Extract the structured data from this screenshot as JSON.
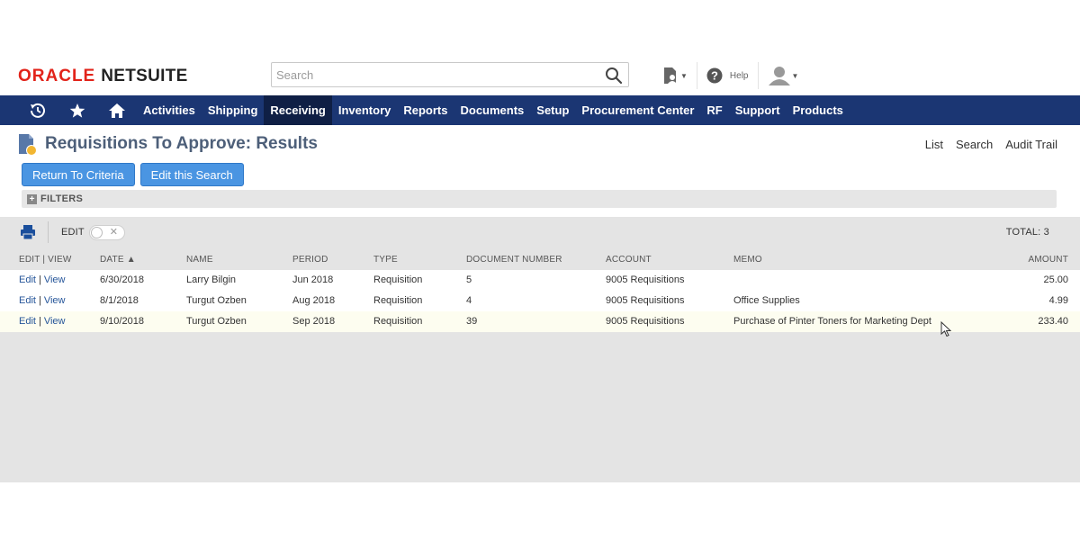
{
  "logo": {
    "oracle": "ORACLE",
    "netsuite": "NETSUITE"
  },
  "search": {
    "placeholder": "Search",
    "value": ""
  },
  "top_icons": {
    "help_label": "Help"
  },
  "nav": {
    "items": [
      {
        "label": "Activities"
      },
      {
        "label": "Shipping"
      },
      {
        "label": "Receiving",
        "active": true
      },
      {
        "label": "Inventory"
      },
      {
        "label": "Reports"
      },
      {
        "label": "Documents"
      },
      {
        "label": "Setup"
      },
      {
        "label": "Procurement Center"
      },
      {
        "label": "RF"
      },
      {
        "label": "Support"
      },
      {
        "label": "Products"
      }
    ]
  },
  "page": {
    "title": "Requisitions To Approve: Results",
    "links": {
      "list": "List",
      "search": "Search",
      "audit_trail": "Audit Trail"
    }
  },
  "buttons": {
    "return_to_criteria": "Return To Criteria",
    "edit_this_search": "Edit this Search"
  },
  "filters": {
    "label": "FILTERS"
  },
  "toolbar": {
    "edit_label": "EDIT",
    "total": "TOTAL: 3"
  },
  "table": {
    "headers": {
      "edit_view": "EDIT | VIEW",
      "date": "DATE ▲",
      "name": "NAME",
      "period": "PERIOD",
      "type": "TYPE",
      "document_number": "DOCUMENT NUMBER",
      "account": "ACCOUNT",
      "memo": "MEMO",
      "amount": "AMOUNT"
    },
    "edit_link": "Edit",
    "view_link": "View",
    "rows": [
      {
        "date": "6/30/2018",
        "name": "Larry Bilgin",
        "period": "Jun 2018",
        "type": "Requisition",
        "document_number": "5",
        "account": "9005 Requisitions",
        "memo": "",
        "amount": "25.00"
      },
      {
        "date": "8/1/2018",
        "name": "Turgut Ozben",
        "period": "Aug 2018",
        "type": "Requisition",
        "document_number": "4",
        "account": "9005 Requisitions",
        "memo": "Office Supplies",
        "amount": "4.99"
      },
      {
        "date": "9/10/2018",
        "name": "Turgut Ozben",
        "period": "Sep 2018",
        "type": "Requisition",
        "document_number": "39",
        "account": "9005 Requisitions",
        "memo": "Purchase of Pinter Toners for Marketing Dept",
        "amount": "233.40"
      }
    ]
  },
  "colors": {
    "nav_bg": "#1b3673",
    "nav_active": "#0f1f45",
    "button": "#4a95e2",
    "link": "#255599",
    "title": "#4d5f79",
    "oracle_red": "#e2231a"
  }
}
